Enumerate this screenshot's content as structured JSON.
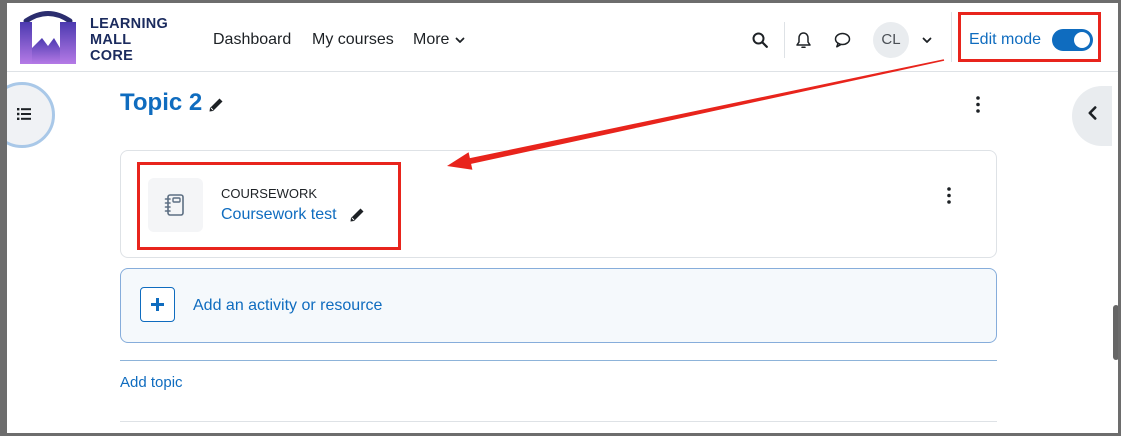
{
  "logo": {
    "line1": "LEARNING",
    "line2": "MALL",
    "line3": "CORE"
  },
  "nav": {
    "items": [
      {
        "label": "Dashboard"
      },
      {
        "label": "My courses"
      },
      {
        "label": "More"
      }
    ]
  },
  "header": {
    "user": {
      "initials": "CL"
    },
    "edit_mode": {
      "label": "Edit mode",
      "enabled": true
    }
  },
  "section": {
    "title": "Topic 2",
    "activity": {
      "type_label": "COURSEWORK",
      "name": "Coursework test"
    },
    "add_activity_label": "Add an activity or resource"
  },
  "add_topic_label": "Add topic",
  "icons": {
    "logo": "learning-mall-logo",
    "search": "search-icon",
    "notifications": "bell-icon",
    "messages": "chat-icon",
    "user_menu": "chevron-down-icon",
    "more_menu": "chevron-down-icon",
    "edit_title": "pencil-icon",
    "section_menu": "kebab-menu-icon",
    "activity": "notebook-icon",
    "add": "plus-icon",
    "course_index": "list-icon",
    "block_drawer": "chevron-left-icon"
  },
  "colors": {
    "accent": "#0f6cbf",
    "annotation": "#e8241c",
    "text": "#1d2125"
  }
}
